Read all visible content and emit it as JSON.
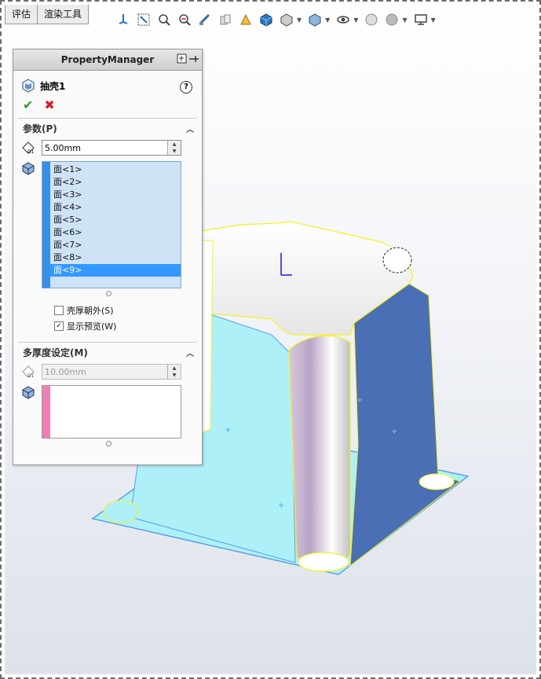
{
  "tabs": [
    "评估",
    "渲染工具"
  ],
  "toolbar": {
    "icons": [
      "view-orientation-icon",
      "zoom-to-fit-icon",
      "zoom-area-icon",
      "previous-view-icon",
      "section-view-icon",
      "dynamic-annotation-icon",
      "display-style-icon",
      "hide-show-icon",
      "edit-appearance-icon",
      "apply-scene-icon",
      "view-settings-icon",
      "display-pane-icon"
    ]
  },
  "property_manager": {
    "title": "PropertyManager",
    "feature_name": "抽壳1",
    "help_label": "?",
    "ok_label": "✔",
    "cancel_label": "✖",
    "parameters": {
      "header": "参数(P)",
      "thickness_icon_label": "D1",
      "thickness_value": "5.00mm",
      "faces": [
        "面<1>",
        "面<2>",
        "面<3>",
        "面<4>",
        "面<5>",
        "面<6>",
        "面<7>",
        "面<8>",
        "面<9>"
      ],
      "selected_face": "面<9>",
      "shell_outward_label": "壳厚朝外(S)",
      "shell_outward_checked": false,
      "show_preview_label": "显示预览(W)",
      "show_preview_checked": true
    },
    "multi_thickness": {
      "header": "多厚度设定(M)",
      "thickness_icon_label": "D1",
      "thickness_value": "10.00mm"
    }
  },
  "colors": {
    "face_selected": "#3399ff",
    "list_bg": "#cfe3f7",
    "pink_bar": "#f07fb5",
    "model_blue": "#4a6fb5",
    "model_cyan": "#aef0f8",
    "edge_yellow": "#f7f020"
  }
}
